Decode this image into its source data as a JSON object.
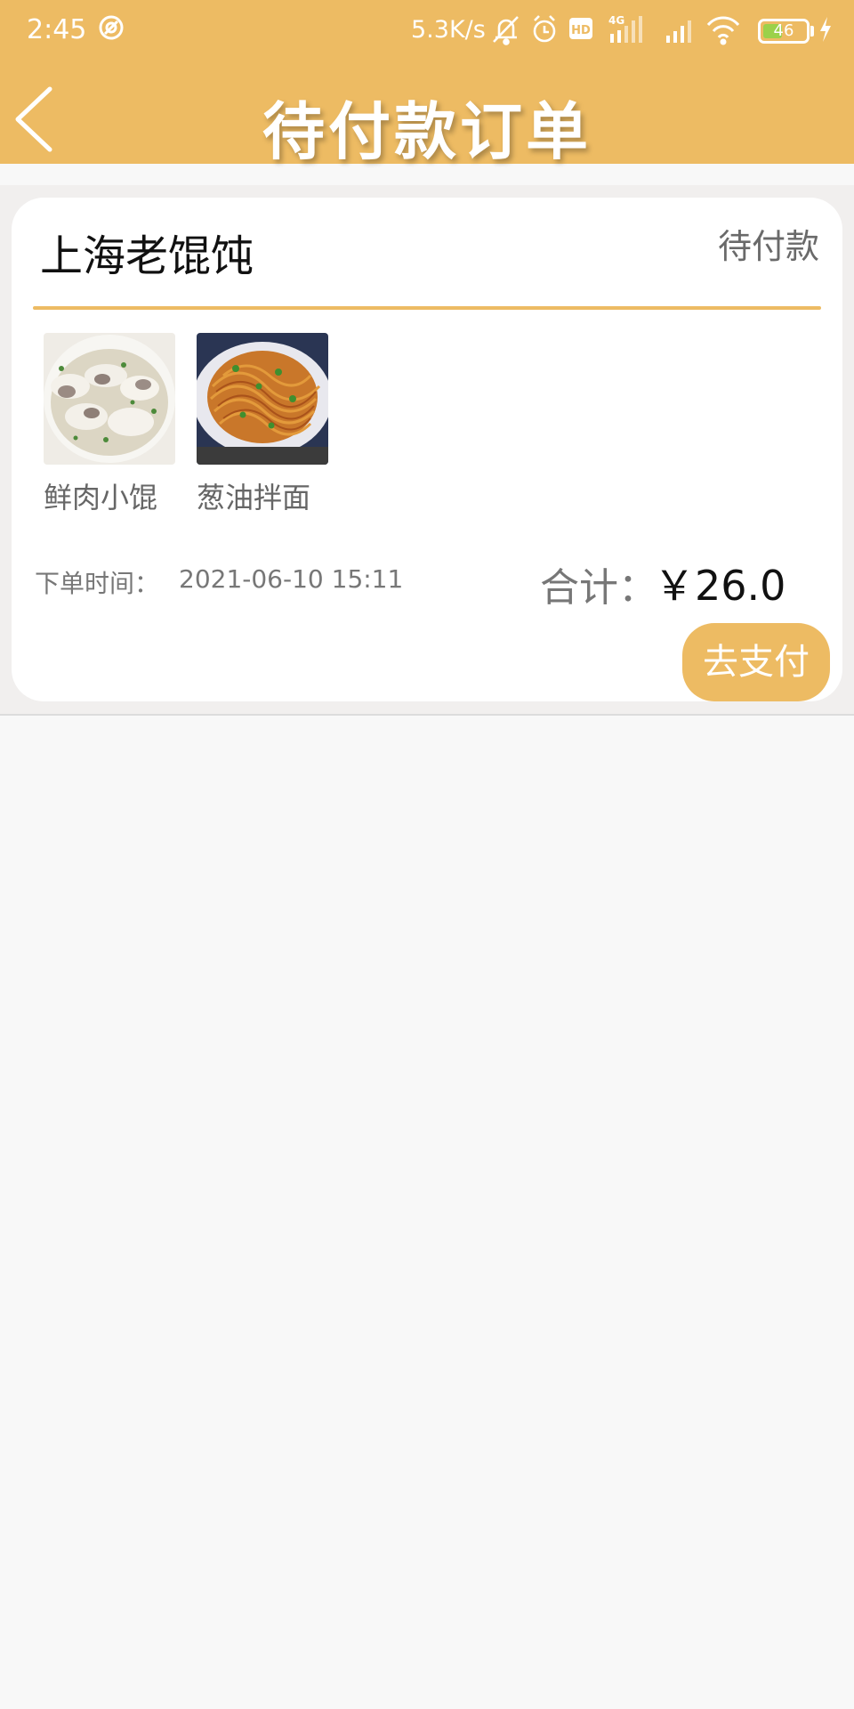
{
  "status_bar": {
    "time": "2:45",
    "net_speed": "5.3K/s",
    "network": "4G",
    "hd": "HD",
    "battery": "46",
    "battery_fraction": 0.46
  },
  "header": {
    "title": "待付款订单",
    "back_icon": "chevron-left-icon",
    "color": "#edbb63"
  },
  "order": {
    "shop_name": "上海老馄饨",
    "status": "待付款",
    "items": [
      {
        "name": "鲜肉小馄",
        "image": "wonton-soup"
      },
      {
        "name": "葱油拌面",
        "image": "scallion-noodles"
      }
    ],
    "time_label": "下单时间：",
    "time_value": "2021-06-10 15:11",
    "total_label": "合计：",
    "total_value": "￥26.0",
    "pay_button": "去支付"
  }
}
